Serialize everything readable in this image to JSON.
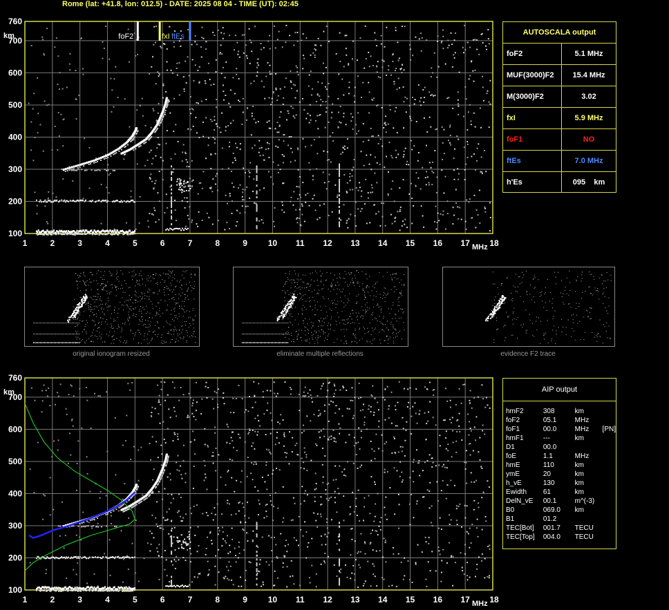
{
  "header": {
    "title": "Rome (lat: +41.8, lon: 012.5) - DATE: 2025 08 04 - TIME (UT): 02:45"
  },
  "colors": {
    "axis": "#d8d84a",
    "grid": "#7a7a7a",
    "white": "#ffffff",
    "yellow": "#ffff66",
    "red": "#ff2020",
    "blue": "#4a8aff",
    "green": "#22dd22",
    "profile_blue": "#2222ff"
  },
  "chart_data": [
    {
      "type": "scatter",
      "title": "",
      "xlabel": "MHz",
      "ylabel": "km",
      "x_ticks": [
        "1",
        "2",
        "3",
        "4",
        "5",
        "6",
        "7",
        "8",
        "9",
        "10",
        "11",
        "12",
        "13",
        "14",
        "15",
        "16",
        "17",
        "18"
      ],
      "y_ticks": [
        "100",
        "200",
        "300",
        "400",
        "500",
        "600",
        "700",
        "760"
      ],
      "xlim": [
        1,
        18
      ],
      "ylim": [
        100,
        760
      ],
      "grid": true,
      "markers": [
        {
          "label": "foF2",
          "x": 5.1,
          "color": "#ffffff"
        },
        {
          "label": "fxI",
          "x": 5.9,
          "color": "#ffff66"
        },
        {
          "label": "ftEs",
          "x": 7.0,
          "color": "#4a8aff"
        }
      ],
      "traces": [
        {
          "name": "",
          "x": [
            2.4,
            3.0,
            3.5,
            4.0,
            4.4,
            4.7,
            4.9,
            5.0,
            5.05
          ],
          "y": [
            300,
            315,
            328,
            345,
            365,
            385,
            405,
            420,
            430
          ]
        },
        {
          "name": "",
          "x": [
            4.5,
            4.8,
            5.1,
            5.4,
            5.6,
            5.8,
            5.9,
            6.0,
            6.1,
            6.15
          ],
          "y": [
            350,
            362,
            378,
            395,
            415,
            440,
            460,
            480,
            505,
            525
          ]
        }
      ]
    },
    {
      "type": "line",
      "title": "",
      "xlabel": "MHz",
      "ylabel": "km",
      "x_ticks": [
        "1",
        "2",
        "3",
        "4",
        "5",
        "6",
        "7",
        "8",
        "9",
        "10",
        "11",
        "12",
        "13",
        "14",
        "15",
        "16",
        "17",
        "18"
      ],
      "y_ticks": [
        "100",
        "200",
        "300",
        "400",
        "500",
        "600",
        "700",
        "760"
      ],
      "xlim": [
        1,
        18
      ],
      "ylim": [
        100,
        760
      ],
      "grid": true,
      "series": [
        {
          "name": "",
          "color": "#22dd22",
          "x": [
            1.0,
            1.3,
            1.7,
            2.2,
            2.8,
            3.4,
            4.0,
            4.5,
            4.9,
            5.0,
            4.8,
            4.2,
            3.4,
            2.5,
            1.8,
            1.3,
            1.0
          ],
          "y": [
            680,
            620,
            560,
            510,
            470,
            440,
            410,
            380,
            345,
            320,
            305,
            290,
            270,
            240,
            210,
            185,
            160
          ]
        },
        {
          "name": "",
          "color": "#2222ff",
          "x": [
            1.15,
            1.3,
            1.6,
            2.0,
            2.6,
            3.2,
            3.8,
            4.3,
            4.7,
            5.0
          ],
          "y": [
            270,
            262,
            270,
            285,
            300,
            318,
            337,
            358,
            380,
            405
          ]
        }
      ]
    }
  ],
  "autoscala": {
    "title": "AUTOSCALA output",
    "rows": [
      {
        "label": "foF2",
        "value": "5.1 MHz",
        "color": "#ffffff"
      },
      {
        "label": "MUF(3000)F2",
        "value": "15.4 MHz",
        "color": "#ffffff"
      },
      {
        "label": "M(3000)F2",
        "value": "3.02",
        "color": "#ffffff"
      },
      {
        "label": "fxI",
        "value": "5.9 MHz",
        "color": "#ffff66"
      },
      {
        "label": "foF1",
        "value": "NO",
        "color": "#ff2020"
      },
      {
        "label": "ftEs",
        "value": "7.0 MHz",
        "color": "#4a8aff"
      },
      {
        "label": "h'Es",
        "value": "095    km",
        "color": "#ffffff"
      }
    ]
  },
  "thumbnails": [
    {
      "caption": "original ionogram resized"
    },
    {
      "caption": "eliminate multiple reflections"
    },
    {
      "caption": "evidence F2 trace"
    }
  ],
  "aip": {
    "title": "AIP output",
    "rows": [
      [
        "hmF2",
        "308",
        "km",
        ""
      ],
      [
        "foF2",
        "05.1",
        "MHz",
        ""
      ],
      [
        "foF1",
        "00.0",
        "MHz",
        "[PN]"
      ],
      [
        "hmF1",
        "---",
        "km",
        ""
      ],
      [
        "D1",
        "00.0",
        "",
        ""
      ],
      [
        "foE",
        "1.1",
        "MHz",
        ""
      ],
      [
        "hmE",
        "110",
        "km",
        ""
      ],
      [
        "ymE",
        "20",
        "km",
        ""
      ],
      [
        "h_vE",
        "130",
        "km",
        ""
      ],
      [
        "Ewidth",
        "61",
        "km",
        ""
      ],
      [
        "DelN_vE",
        "00.1",
        "m^(-3)",
        ""
      ],
      [
        "B0",
        "069.0",
        "km",
        ""
      ],
      [
        "B1",
        "01.2",
        "",
        ""
      ],
      [
        "TEC[Bot]",
        "001.7",
        "TECU",
        ""
      ],
      [
        "TEC[Top]",
        "004.0",
        "TECU",
        ""
      ]
    ]
  }
}
